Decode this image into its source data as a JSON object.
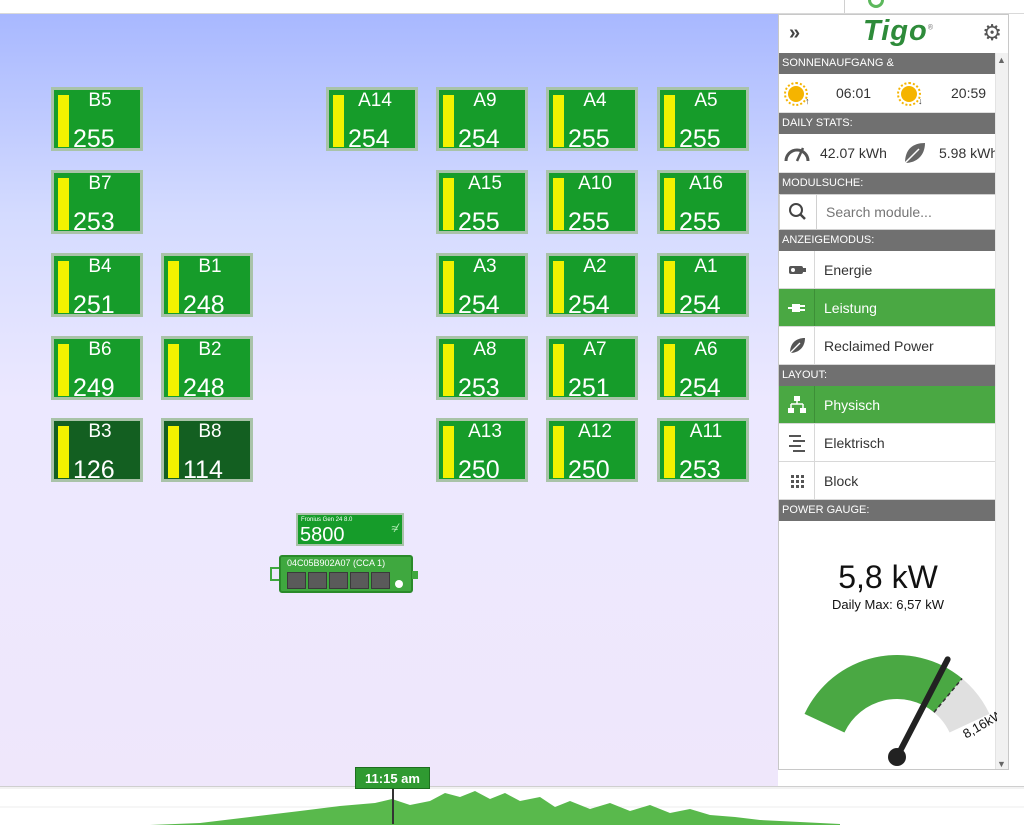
{
  "canvas": {
    "panels": [
      {
        "label": "B5",
        "value": "255",
        "dim": false
      },
      {
        "label": "A14",
        "value": "254",
        "dim": false
      },
      {
        "label": "A9",
        "value": "254",
        "dim": false
      },
      {
        "label": "A4",
        "value": "255",
        "dim": false
      },
      {
        "label": "A5",
        "value": "255",
        "dim": false
      },
      {
        "label": "B7",
        "value": "253",
        "dim": false
      },
      {
        "label": "A15",
        "value": "255",
        "dim": false
      },
      {
        "label": "A10",
        "value": "255",
        "dim": false
      },
      {
        "label": "A16",
        "value": "255",
        "dim": false
      },
      {
        "label": "B4",
        "value": "251",
        "dim": false
      },
      {
        "label": "B1",
        "value": "248",
        "dim": false
      },
      {
        "label": "A3",
        "value": "254",
        "dim": false
      },
      {
        "label": "A2",
        "value": "254",
        "dim": false
      },
      {
        "label": "A1",
        "value": "254",
        "dim": false
      },
      {
        "label": "B6",
        "value": "249",
        "dim": false
      },
      {
        "label": "B2",
        "value": "248",
        "dim": false
      },
      {
        "label": "A8",
        "value": "253",
        "dim": false
      },
      {
        "label": "A7",
        "value": "251",
        "dim": false
      },
      {
        "label": "A6",
        "value": "254",
        "dim": false
      },
      {
        "label": "B3",
        "value": "126",
        "dim": true
      },
      {
        "label": "B8",
        "value": "114",
        "dim": true
      },
      {
        "label": "A13",
        "value": "250",
        "dim": false
      },
      {
        "label": "A12",
        "value": "250",
        "dim": false
      },
      {
        "label": "A11",
        "value": "253",
        "dim": false
      }
    ],
    "inverter": {
      "name": "Fronius Gen 24 8.0",
      "value": "5800"
    },
    "cca": {
      "name": "04C05B902A07 (CCA 1)"
    }
  },
  "timeline": {
    "time": "11:15 am"
  },
  "sidebar": {
    "expand_icon": "double-chevron-right-icon",
    "logo": "Tigo",
    "settings_icon": "gear-icon",
    "sun_header": "SONNENAUFGANG & SONNENUNTERGANG:",
    "sunrise": "06:01",
    "sunset": "20:59",
    "stats_header": "DAILY STATS:",
    "energy": "42.07 kWh",
    "reclaimed": "5.98 kWh",
    "search_header": "MODULSUCHE:",
    "search_placeholder": "Search module...",
    "mode_header": "ANZEIGEMODUS:",
    "modes": [
      {
        "label": "Energie",
        "icon": "battery-icon",
        "active": false
      },
      {
        "label": "Leistung",
        "icon": "plug-icon",
        "active": true
      },
      {
        "label": "Reclaimed Power",
        "icon": "leaf-icon",
        "active": false
      }
    ],
    "layout_header": "LAYOUT:",
    "layouts": [
      {
        "label": "Physisch",
        "icon": "hierarchy-icon",
        "active": true
      },
      {
        "label": "Elektrisch",
        "icon": "circuit-icon",
        "active": false
      },
      {
        "label": "Block",
        "icon": "grid-icon",
        "active": false
      }
    ],
    "gauge_header": "POWER GAUGE:",
    "gauge": {
      "value_text": "5,8 kW",
      "max_text": "Daily Max: 6,57 kW",
      "capacity_text": "8,16kW",
      "value": 5.8,
      "daily_max": 6.57,
      "capacity": 8.16
    }
  },
  "colors": {
    "panel_green": "#169c2a",
    "panel_dim": "#135f21",
    "accent": "#4aa843"
  }
}
